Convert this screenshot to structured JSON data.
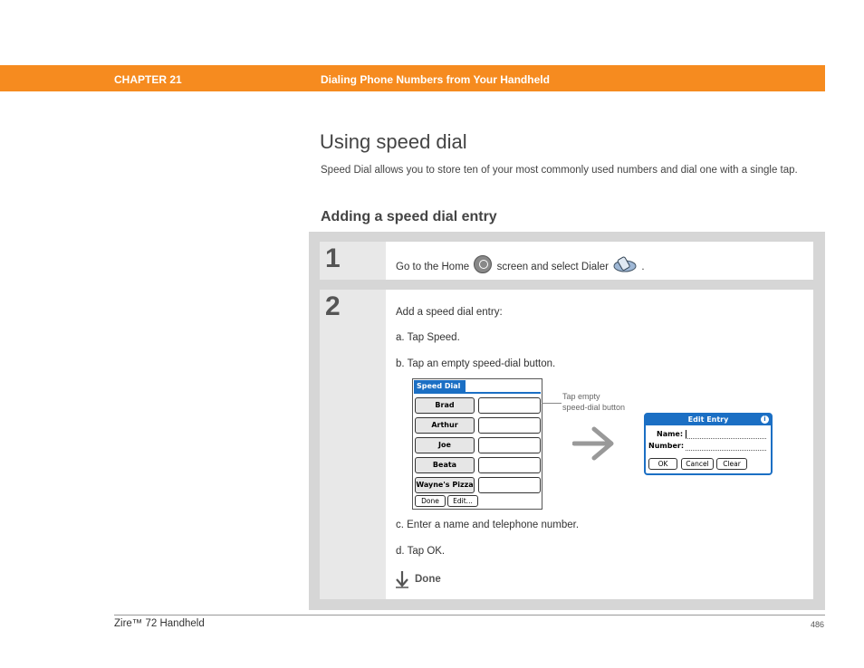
{
  "header": {
    "chapter": "CHAPTER 21",
    "title": "Dialing Phone Numbers from Your Handheld",
    "color": "#f68b1f"
  },
  "page_title": "Using speed dial",
  "intro": "Speed Dial allows you to store ten of your most commonly used numbers and dial one with a single tap.",
  "subheading": "Adding a speed dial entry",
  "steps": [
    {
      "number": "1",
      "text_before": "Go to the Home",
      "icon1": "home-icon",
      "text_middle": "screen and select Dialer",
      "icon2": "dialer-icon",
      "text_after": "."
    },
    {
      "number": "2",
      "intro": "Add a speed dial entry:",
      "substeps": [
        "a.  Tap Speed.",
        "b.  Tap an empty speed-dial button.",
        "c.  Enter a name and telephone number.",
        "d.  Tap OK."
      ]
    }
  ],
  "speed_dial_screen": {
    "title": "Speed Dial",
    "entries": [
      "Brad",
      "Arthur",
      "Joe",
      "Beata",
      "Wayne's Pizza"
    ],
    "buttons": [
      "Done",
      "Edit..."
    ]
  },
  "callout": {
    "line1": "Tap empty",
    "line2": "speed-dial button"
  },
  "edit_entry_dialog": {
    "title": "Edit Entry",
    "info_glyph": "i",
    "name_label": "Name:",
    "number_label": "Number:",
    "buttons": [
      "OK",
      "Cancel",
      "Clear"
    ]
  },
  "done_label": "Done",
  "footer": {
    "product": "Zire™ 72 Handheld",
    "page": "486"
  }
}
